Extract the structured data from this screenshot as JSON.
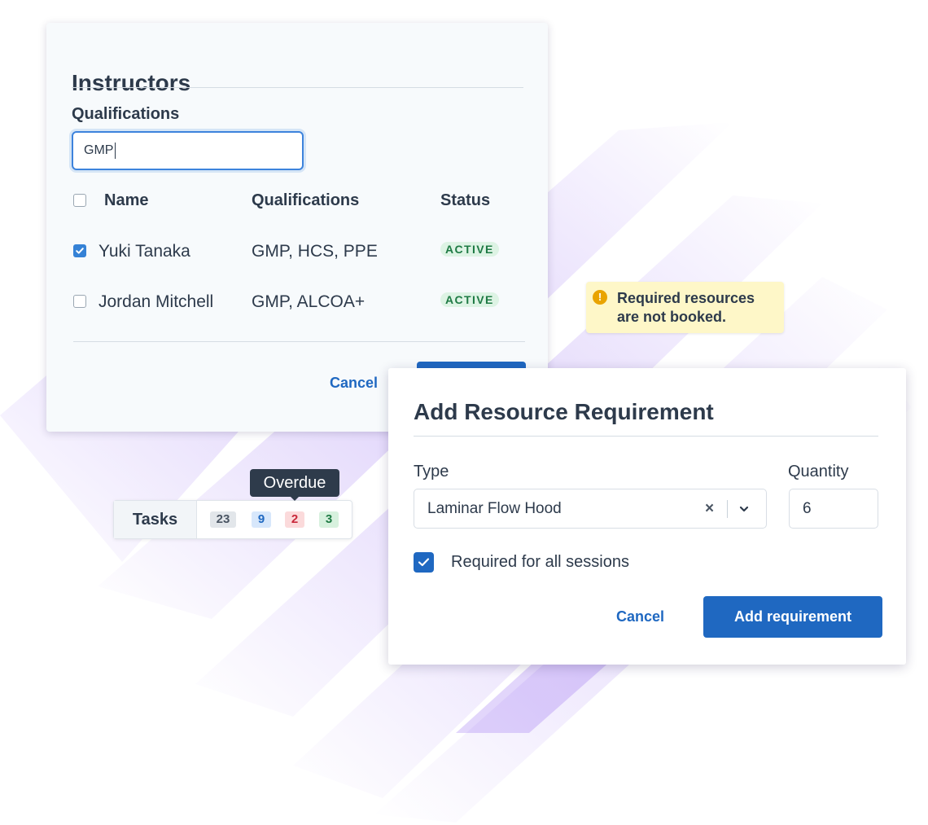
{
  "instructors_panel": {
    "title": "Instructors",
    "filter_label": "Qualifications",
    "filter_value": "GMP",
    "columns": [
      "Name",
      "Qualifications",
      "Status"
    ],
    "rows": [
      {
        "name": "Yuki Tanaka",
        "qualifications": "GMP, HCS, PPE",
        "status": "ACTIVE",
        "checked": true
      },
      {
        "name": "Jordan Mitchell",
        "qualifications": "GMP, ALCOA+",
        "status": "ACTIVE",
        "checked": false
      }
    ],
    "cancel_label": "Cancel"
  },
  "warning": {
    "icon": "exclamation-icon",
    "text": "Required resources are not booked."
  },
  "tasks_widget": {
    "label": "Tasks",
    "counts": {
      "total": "23",
      "blue": "9",
      "red": "2",
      "green": "3"
    },
    "tooltip": "Overdue"
  },
  "resource_dialog": {
    "title": "Add Resource Requirement",
    "type_label": "Type",
    "type_value": "Laminar Flow Hood",
    "quantity_label": "Quantity",
    "quantity_value": "6",
    "required_all_label": "Required for all sessions",
    "required_all_checked": true,
    "cancel_label": "Cancel",
    "submit_label": "Add requirement"
  },
  "colors": {
    "primary": "#1f68c1",
    "accent_purple": "#8a5cf0",
    "badge_active_bg": "#ddf3e4",
    "warning_bg": "#fef7c8"
  }
}
